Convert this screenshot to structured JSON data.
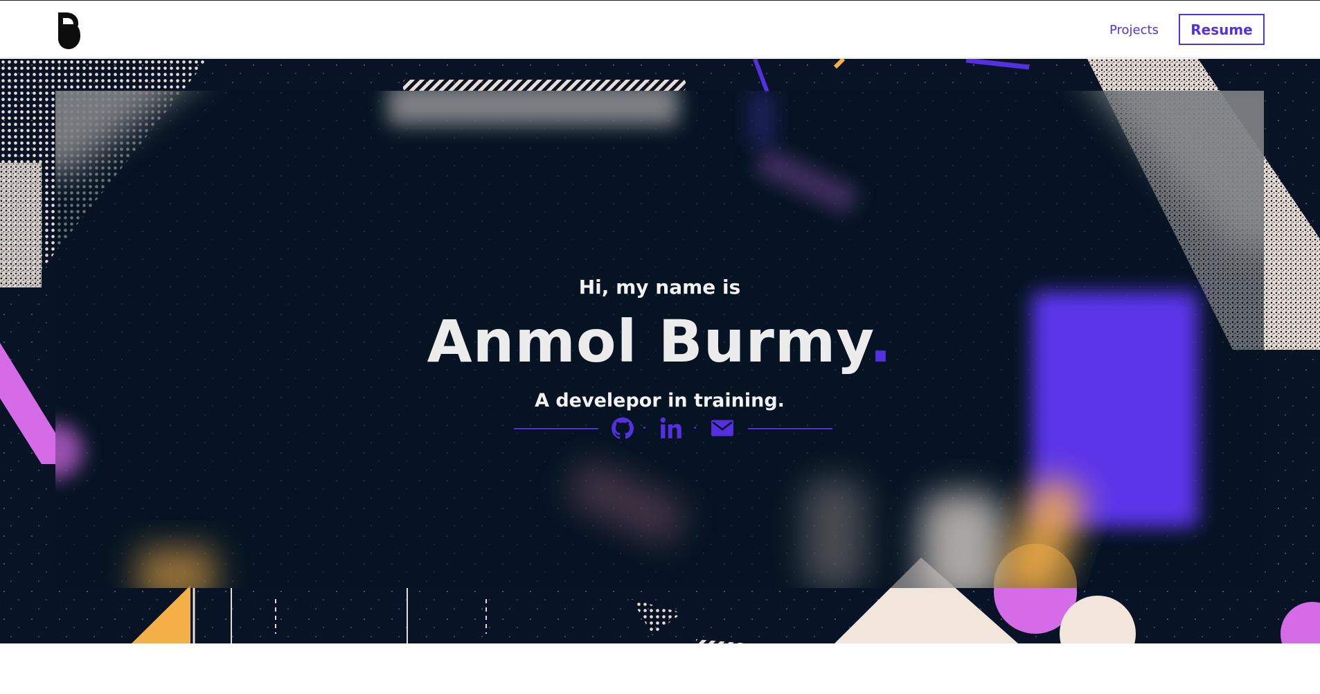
{
  "header": {
    "nav_projects": "Projects",
    "nav_resume": "Resume",
    "logo_icon": "b-monogram-icon"
  },
  "hero": {
    "greeting": "Hi, my name is",
    "name": "Anmol Burmy",
    "name_dot": ".",
    "tagline": "A develepor in training.",
    "socials": [
      {
        "icon": "github-icon"
      },
      {
        "icon": "linkedin-icon"
      },
      {
        "icon": "email-icon"
      }
    ]
  },
  "colors": {
    "accent": "#5530e0",
    "hero_background": "#081425",
    "text_light": "#ececec",
    "pink": "#d66be8",
    "orange": "#f6b04a",
    "cream": "#f1e5dc"
  }
}
